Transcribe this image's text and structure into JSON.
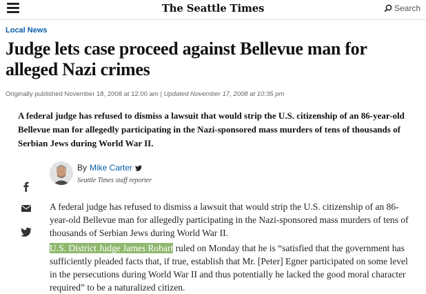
{
  "header": {
    "logo": "The Seattle Times",
    "search_label": "Search"
  },
  "article": {
    "section": "Local News",
    "headline": "Judge lets case proceed against Bellevue man for alleged Nazi crimes",
    "published": "Originally published November 18, 2008 at 12:00 am",
    "separator": " | ",
    "updated": "Updated November 17, 2008 at 10:35 pm",
    "summary": "A federal judge has refused to dismiss a lawsuit that would strip the U.S. citizenship of an 86-year-old Bellevue man for allegedly participating in the Nazi-sponsored mass murders of tens of thousands of Serbian Jews during World War II.",
    "author": {
      "by": "By",
      "name": "Mike Carter",
      "role": "Seattle Times staff reporter"
    },
    "paragraphs": {
      "p1": "A federal judge has refused to dismiss a lawsuit that would strip the U.S. citizenship of an 86-year-old Bellevue man for allegedly participating in the Nazi-sponsored mass murders of tens of thousands of Serbian Jews during World War II.",
      "p2_highlight": "U.S. District Judge James Robart",
      "p2_rest": " ruled on Monday that he is “satisfied that the government has sufficiently pleaded facts that, if true, establish that Mr. [Peter] Egner participated on some level in the persecutions during World War II and thus potentially he lacked the good moral character required” to be a naturalized citizen."
    }
  },
  "share": {
    "icons": [
      "facebook-icon",
      "email-icon",
      "twitter-icon"
    ]
  },
  "colors": {
    "link": "#0a5da8",
    "highlight": "#8fb86e"
  }
}
